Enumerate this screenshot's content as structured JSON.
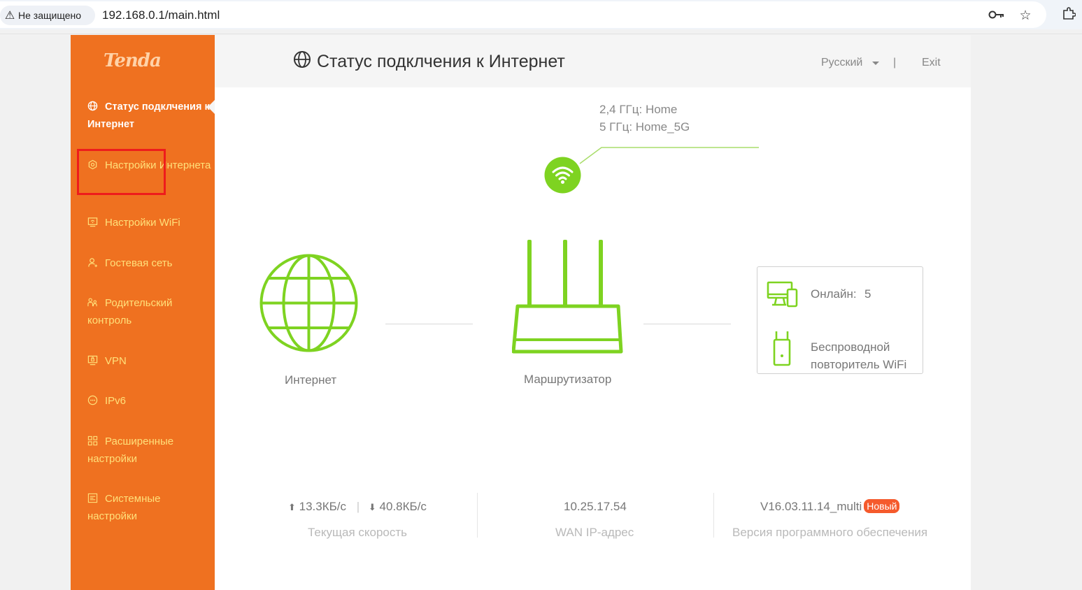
{
  "browser": {
    "security_label": "Не защищено",
    "url": "192.168.0.1/main.html",
    "icons": [
      "warning-icon",
      "key-icon",
      "star-icon",
      "extension-icon"
    ]
  },
  "sidebar": {
    "logo": "Tenda",
    "items": [
      {
        "label": "Статус подклчения к Интернет",
        "icon": "globe-icon",
        "active": true
      },
      {
        "label": "Настройки Интернета",
        "icon": "internet-settings-icon",
        "highlighted": true
      },
      {
        "label": "Настройки WiFi",
        "icon": "wifi-settings-icon"
      },
      {
        "label": "Гостевая сеть",
        "icon": "guest-icon"
      },
      {
        "label": "Родительский контроль",
        "icon": "parental-icon"
      },
      {
        "label": "VPN",
        "icon": "vpn-icon"
      },
      {
        "label": "IPv6",
        "icon": "ipv6-icon"
      },
      {
        "label": "Расширенные настройки",
        "icon": "advanced-icon"
      },
      {
        "label": "Системные настройки",
        "icon": "system-icon"
      }
    ]
  },
  "header": {
    "title": "Статус подклчения к Интернет",
    "language": "Русский",
    "separator": "|",
    "exit": "Exit"
  },
  "wifi": {
    "ssid_24": "2,4 ГГц: Home",
    "ssid_5": "5 ГГц: Home_5G"
  },
  "topology": {
    "internet_label": "Интернет",
    "router_label": "Маршрутизатор",
    "online_label": "Онлайн:",
    "online_count": "5",
    "repeater_label_1": "Беспроводной",
    "repeater_label_2": "повторитель WiFi"
  },
  "stats": {
    "up_arrow": "⬆",
    "upload": "13.3КБ/с",
    "speed_sep": "|",
    "down_arrow": "⬇",
    "download": "40.8КБ/с",
    "speed_label": "Текущая скорость",
    "wan_ip": "10.25.17.54",
    "wan_label": "WAN IP-адрес",
    "firmware": "V16.03.11.14_multi",
    "new_badge": "Новый",
    "firmware_label": "Версия программного обеспечения"
  },
  "colors": {
    "sidebar": "#ef7120",
    "sidebar_text": "#ffe07a",
    "accent_green": "#7ed321",
    "badge": "#f55a2c",
    "highlight": "#ee1c1c"
  }
}
